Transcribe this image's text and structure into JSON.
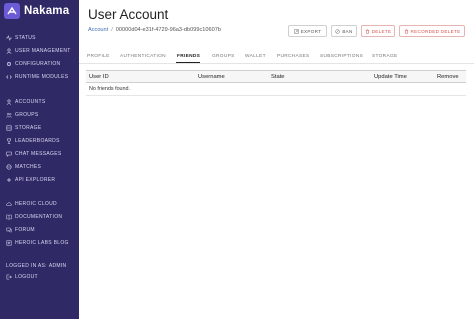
{
  "brand": {
    "name": "Nakama",
    "accent": "#6b5cd6"
  },
  "sidebar": {
    "group1": [
      {
        "label": "STATUS",
        "icon": "status-icon"
      },
      {
        "label": "USER MANAGEMENT",
        "icon": "users-icon"
      },
      {
        "label": "CONFIGURATION",
        "icon": "gear-icon"
      },
      {
        "label": "RUNTIME MODULES",
        "icon": "code-icon"
      }
    ],
    "group2": [
      {
        "label": "ACCOUNTS",
        "icon": "person-icon"
      },
      {
        "label": "GROUPS",
        "icon": "group-icon"
      },
      {
        "label": "STORAGE",
        "icon": "storage-icon"
      },
      {
        "label": "LEADERBOARDS",
        "icon": "trophy-icon"
      },
      {
        "label": "CHAT MESSAGES",
        "icon": "chat-icon"
      },
      {
        "label": "MATCHES",
        "icon": "match-icon"
      },
      {
        "label": "API EXPLORER",
        "icon": "api-icon"
      }
    ],
    "group3": [
      {
        "label": "HEROIC CLOUD",
        "icon": "cloud-icon"
      },
      {
        "label": "DOCUMENTATION",
        "icon": "book-icon"
      },
      {
        "label": "FORUM",
        "icon": "forum-icon"
      },
      {
        "label": "HEROIC LABS BLOG",
        "icon": "blog-icon"
      }
    ],
    "logged_in_label": "LOGGED IN AS:",
    "logged_in_user": "ADMIN",
    "logout_label": "LOGOUT"
  },
  "header": {
    "title": "User Account",
    "breadcrumb_root": "Account",
    "breadcrumb_id": "00000d04-e31f-4729-96a3-db099c10607b"
  },
  "actions": {
    "export": "EXPORT",
    "ban": "BAN",
    "delete": "DELETE",
    "recorded_delete": "RECORDED DELETE"
  },
  "tabs": [
    "PROFILE",
    "AUTHENTICATION",
    "FRIENDS",
    "GROUPS",
    "WALLET",
    "PURCHASES",
    "SUBSCRIPTIONS",
    "STORAGE"
  ],
  "active_tab": "FRIENDS",
  "table": {
    "columns": [
      "User ID",
      "Username",
      "State",
      "Update Time",
      "Remove"
    ],
    "empty_message": "No friends found."
  }
}
